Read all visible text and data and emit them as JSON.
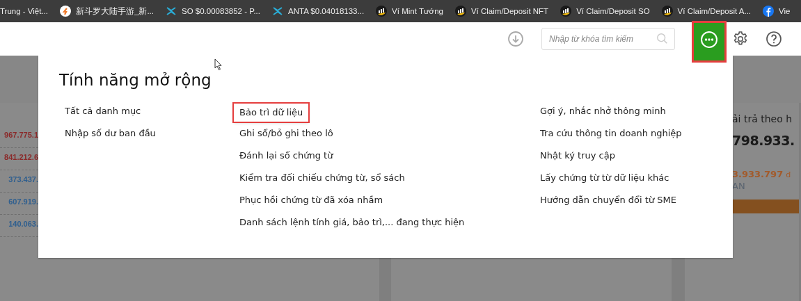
{
  "bookmarks": [
    {
      "label": "Trung - Việt...",
      "kind": "plain"
    },
    {
      "label": "新斗罗大陆手游_新...",
      "kind": "game"
    },
    {
      "label": "SO $0.00083852 - P...",
      "kind": "exchange"
    },
    {
      "label": "ANTA $0.04018133...",
      "kind": "exchange"
    },
    {
      "label": "Ví Mint Tướng",
      "kind": "wallet"
    },
    {
      "label": "Ví Claim/Deposit NFT",
      "kind": "wallet"
    },
    {
      "label": "Ví Claim/Deposit SO",
      "kind": "wallet"
    },
    {
      "label": "Ví Claim/Deposit A...",
      "kind": "wallet"
    },
    {
      "label": "Vie",
      "kind": "social"
    }
  ],
  "header": {
    "search": {
      "placeholder": "Nhập từ khóa tìm kiếm"
    },
    "more_button": {
      "highlighted": true
    }
  },
  "background": {
    "left_values": [
      {
        "text": "967.775.1",
        "color": "#8b2a2a"
      },
      {
        "text": "841.212.6",
        "color": "#8b2a2a"
      },
      {
        "text": "373.437.",
        "color": "#2f5f8f"
      },
      {
        "text": "607.919.",
        "color": "#2f5f8f"
      },
      {
        "text": "140.063.",
        "color": "#2f5f8f"
      }
    ],
    "right_card": {
      "title": "ải trả theo h",
      "amount": "798.933.",
      "sub_amount": "3.933.797",
      "currency": "đ",
      "caption": "AN"
    }
  },
  "panel": {
    "title": "Tính năng mở rộng",
    "columns": [
      [
        {
          "label": "Tất cả danh mục",
          "highlighted": false
        },
        {
          "label": "Nhập số dư ban đầu",
          "highlighted": false
        }
      ],
      [
        {
          "label": "Bảo trì dữ liệu",
          "highlighted": true
        },
        {
          "label": "Ghi sổ/bỏ ghi theo lô",
          "highlighted": false
        },
        {
          "label": "Đánh lại số chứng từ",
          "highlighted": false
        },
        {
          "label": "Kiểm tra đối chiếu chứng từ, sổ sách",
          "highlighted": false
        },
        {
          "label": "Phục hồi chứng từ đã xóa nhầm",
          "highlighted": false
        },
        {
          "label": "Danh sách lệnh tính giá, bảo trì,... đang thực hiện",
          "highlighted": false
        }
      ],
      [
        {
          "label": "Gợi ý, nhắc nhở thông minh",
          "highlighted": false
        },
        {
          "label": "Tra cứu thông tin doanh nghiệp",
          "highlighted": false
        },
        {
          "label": "Nhật ký truy cập",
          "highlighted": false
        },
        {
          "label": "Lấy chứng từ từ dữ liệu khác",
          "highlighted": false
        },
        {
          "label": "Hướng dẫn chuyển đổi từ SME",
          "highlighted": false
        }
      ]
    ]
  }
}
